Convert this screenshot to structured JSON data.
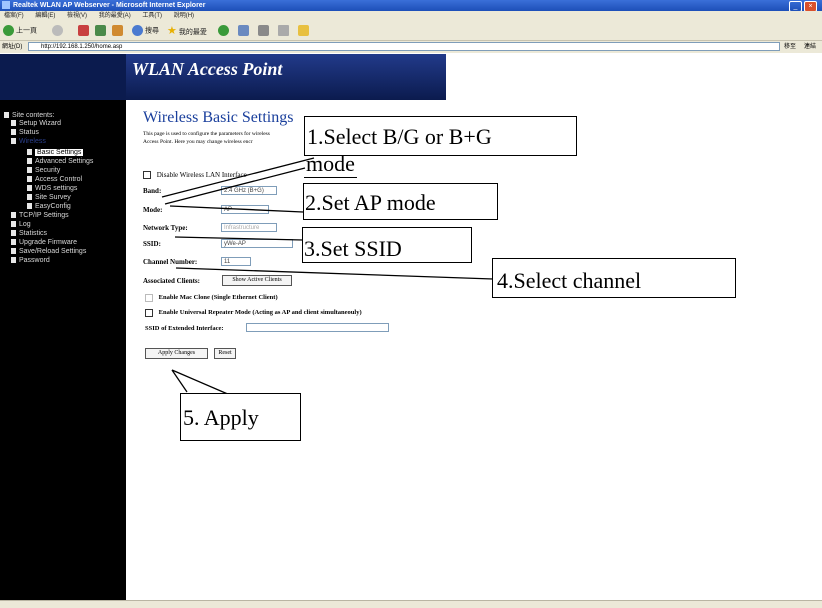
{
  "window": {
    "title": "Realtek WLAN AP Webserver - Microsoft Internet Explorer"
  },
  "menu": [
    "檔案(F)",
    "編輯(E)",
    "檢視(V)",
    "我的最愛(A)",
    "工具(T)",
    "說明(H)"
  ],
  "toolbar": {
    "back_label": "上一頁",
    "search_label": "搜尋",
    "favorites_label": "我的最愛"
  },
  "address": {
    "label": "網址(D)",
    "url": "http://192.168.1.250/home.asp",
    "go_label": "移至",
    "links_label": "連結"
  },
  "banner": {
    "title": "WLAN Access Point"
  },
  "nav": {
    "header": "Site contents:",
    "items": [
      "Setup Wizard",
      "Status",
      "Wireless",
      "Basic Settings",
      "Advanced Settings",
      "Security",
      "Access Control",
      "WDS settings",
      "Site Survey",
      "EasyConfig",
      "TCP/IP Settings",
      "Log",
      "Statistics",
      "Upgrade Firmware",
      "Save/Reload Settings",
      "Password"
    ]
  },
  "page": {
    "heading": "Wireless Basic Settings",
    "desc_line1": "This page is used to configure the parameters for wireless",
    "desc_line2": "Access Point. Here you may change wireless encr",
    "disable_label": "Disable Wireless LAN Interface",
    "band_label": "Band:",
    "band_value": "2.4 GHz (B+G)",
    "mode_label": "Mode:",
    "mode_value": "AP",
    "network_type_label": "Network Type:",
    "network_type_value": "Infrastructure",
    "ssid_label": "SSID:",
    "ssid_value": "yWe-AP",
    "channel_label": "Channel Number:",
    "channel_value": "11",
    "clients_label": "Associated Clients:",
    "clients_button": "Show Active Clients",
    "mac_clone_label": "Enable Mac Clone (Single Ethernet Client)",
    "repeater_label": "Enable Universal Repeater Mode (Acting as AP and client simultaneouly)",
    "ssid_ext_label": "SSID of Extended Interface:",
    "apply_button": "Apply Changes",
    "reset_button": "Reset"
  },
  "annotations": {
    "a1": "1.Select B/G or B+G",
    "a1b": "mode",
    "a2": "2.Set AP mode",
    "a3": "3.Set SSID",
    "a4": "4.Select channel",
    "a5": "5. Apply"
  },
  "colors": {
    "nav_bg": "#000000",
    "banner_bg": "#0b1b4e",
    "heading": "#1a3f9c",
    "xp_chrome": "#ece9d8"
  }
}
